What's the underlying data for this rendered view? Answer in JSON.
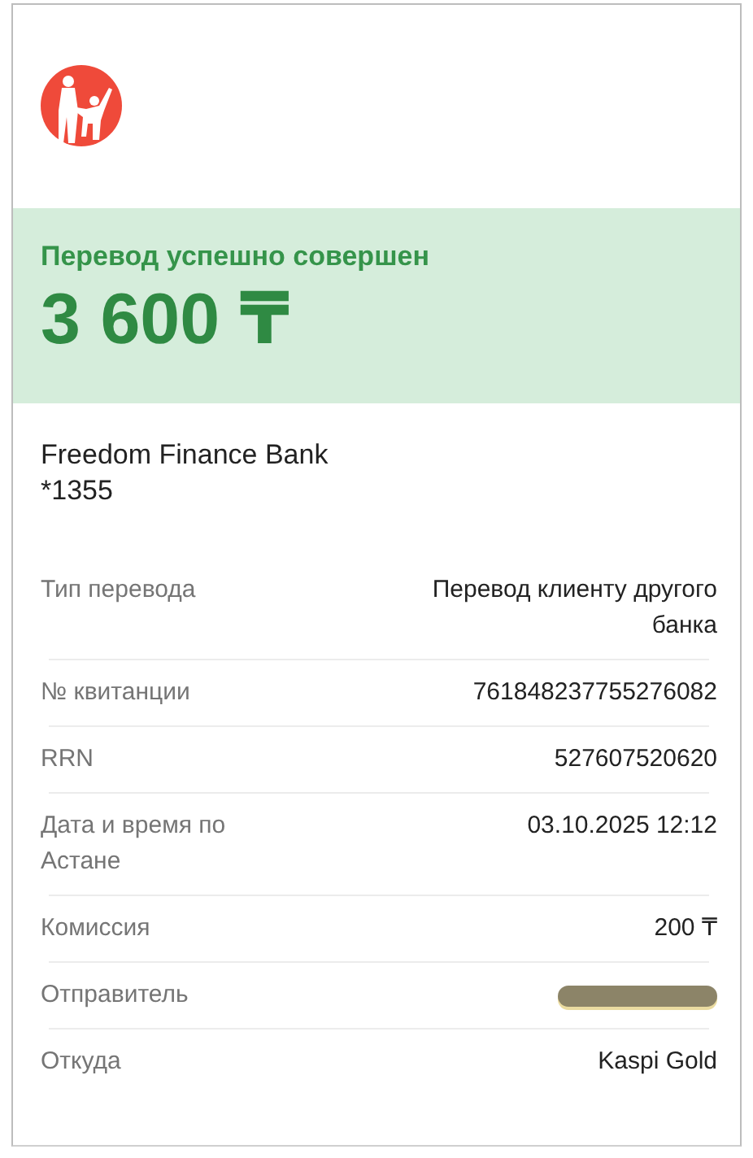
{
  "status": "Перевод успешно совершен",
  "amount": "3 600 ₸",
  "recipient": {
    "bank": "Freedom Finance Bank",
    "account": "*1355"
  },
  "details": [
    {
      "kind": "text",
      "label": "Тип перевода",
      "value": "Перевод клиенту другого банка"
    },
    {
      "kind": "text",
      "label": "№ квитанции",
      "value": "761848237755276082"
    },
    {
      "kind": "text",
      "label": "RRN",
      "value": "527607520620"
    },
    {
      "kind": "text",
      "label": "Дата и время по Астане",
      "value": "03.10.2025 12:12"
    },
    {
      "kind": "text",
      "label": "Комиссия",
      "value": "200 ₸"
    },
    {
      "kind": "redacted",
      "label": "Отправитель"
    },
    {
      "kind": "text",
      "label": "Откуда",
      "value": "Kaspi Gold"
    }
  ]
}
